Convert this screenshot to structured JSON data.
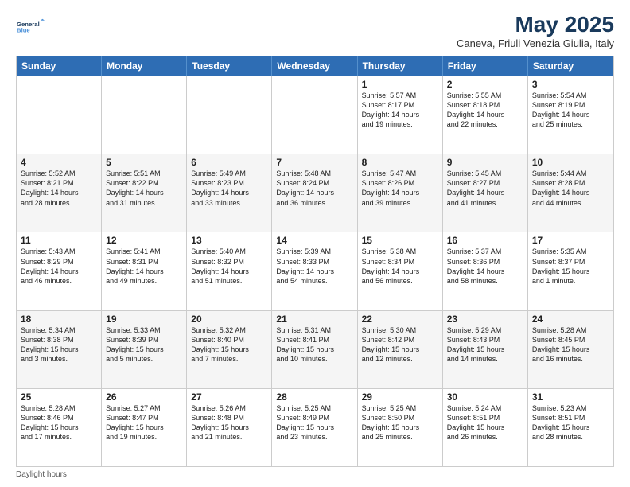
{
  "header": {
    "logo_line1": "General",
    "logo_line2": "Blue",
    "month": "May 2025",
    "location": "Caneva, Friuli Venezia Giulia, Italy"
  },
  "days_of_week": [
    "Sunday",
    "Monday",
    "Tuesday",
    "Wednesday",
    "Thursday",
    "Friday",
    "Saturday"
  ],
  "weeks": [
    [
      {
        "day": "",
        "info": ""
      },
      {
        "day": "",
        "info": ""
      },
      {
        "day": "",
        "info": ""
      },
      {
        "day": "",
        "info": ""
      },
      {
        "day": "1",
        "info": "Sunrise: 5:57 AM\nSunset: 8:17 PM\nDaylight: 14 hours\nand 19 minutes."
      },
      {
        "day": "2",
        "info": "Sunrise: 5:55 AM\nSunset: 8:18 PM\nDaylight: 14 hours\nand 22 minutes."
      },
      {
        "day": "3",
        "info": "Sunrise: 5:54 AM\nSunset: 8:19 PM\nDaylight: 14 hours\nand 25 minutes."
      }
    ],
    [
      {
        "day": "4",
        "info": "Sunrise: 5:52 AM\nSunset: 8:21 PM\nDaylight: 14 hours\nand 28 minutes."
      },
      {
        "day": "5",
        "info": "Sunrise: 5:51 AM\nSunset: 8:22 PM\nDaylight: 14 hours\nand 31 minutes."
      },
      {
        "day": "6",
        "info": "Sunrise: 5:49 AM\nSunset: 8:23 PM\nDaylight: 14 hours\nand 33 minutes."
      },
      {
        "day": "7",
        "info": "Sunrise: 5:48 AM\nSunset: 8:24 PM\nDaylight: 14 hours\nand 36 minutes."
      },
      {
        "day": "8",
        "info": "Sunrise: 5:47 AM\nSunset: 8:26 PM\nDaylight: 14 hours\nand 39 minutes."
      },
      {
        "day": "9",
        "info": "Sunrise: 5:45 AM\nSunset: 8:27 PM\nDaylight: 14 hours\nand 41 minutes."
      },
      {
        "day": "10",
        "info": "Sunrise: 5:44 AM\nSunset: 8:28 PM\nDaylight: 14 hours\nand 44 minutes."
      }
    ],
    [
      {
        "day": "11",
        "info": "Sunrise: 5:43 AM\nSunset: 8:29 PM\nDaylight: 14 hours\nand 46 minutes."
      },
      {
        "day": "12",
        "info": "Sunrise: 5:41 AM\nSunset: 8:31 PM\nDaylight: 14 hours\nand 49 minutes."
      },
      {
        "day": "13",
        "info": "Sunrise: 5:40 AM\nSunset: 8:32 PM\nDaylight: 14 hours\nand 51 minutes."
      },
      {
        "day": "14",
        "info": "Sunrise: 5:39 AM\nSunset: 8:33 PM\nDaylight: 14 hours\nand 54 minutes."
      },
      {
        "day": "15",
        "info": "Sunrise: 5:38 AM\nSunset: 8:34 PM\nDaylight: 14 hours\nand 56 minutes."
      },
      {
        "day": "16",
        "info": "Sunrise: 5:37 AM\nSunset: 8:36 PM\nDaylight: 14 hours\nand 58 minutes."
      },
      {
        "day": "17",
        "info": "Sunrise: 5:35 AM\nSunset: 8:37 PM\nDaylight: 15 hours\nand 1 minute."
      }
    ],
    [
      {
        "day": "18",
        "info": "Sunrise: 5:34 AM\nSunset: 8:38 PM\nDaylight: 15 hours\nand 3 minutes."
      },
      {
        "day": "19",
        "info": "Sunrise: 5:33 AM\nSunset: 8:39 PM\nDaylight: 15 hours\nand 5 minutes."
      },
      {
        "day": "20",
        "info": "Sunrise: 5:32 AM\nSunset: 8:40 PM\nDaylight: 15 hours\nand 7 minutes."
      },
      {
        "day": "21",
        "info": "Sunrise: 5:31 AM\nSunset: 8:41 PM\nDaylight: 15 hours\nand 10 minutes."
      },
      {
        "day": "22",
        "info": "Sunrise: 5:30 AM\nSunset: 8:42 PM\nDaylight: 15 hours\nand 12 minutes."
      },
      {
        "day": "23",
        "info": "Sunrise: 5:29 AM\nSunset: 8:43 PM\nDaylight: 15 hours\nand 14 minutes."
      },
      {
        "day": "24",
        "info": "Sunrise: 5:28 AM\nSunset: 8:45 PM\nDaylight: 15 hours\nand 16 minutes."
      }
    ],
    [
      {
        "day": "25",
        "info": "Sunrise: 5:28 AM\nSunset: 8:46 PM\nDaylight: 15 hours\nand 17 minutes."
      },
      {
        "day": "26",
        "info": "Sunrise: 5:27 AM\nSunset: 8:47 PM\nDaylight: 15 hours\nand 19 minutes."
      },
      {
        "day": "27",
        "info": "Sunrise: 5:26 AM\nSunset: 8:48 PM\nDaylight: 15 hours\nand 21 minutes."
      },
      {
        "day": "28",
        "info": "Sunrise: 5:25 AM\nSunset: 8:49 PM\nDaylight: 15 hours\nand 23 minutes."
      },
      {
        "day": "29",
        "info": "Sunrise: 5:25 AM\nSunset: 8:50 PM\nDaylight: 15 hours\nand 25 minutes."
      },
      {
        "day": "30",
        "info": "Sunrise: 5:24 AM\nSunset: 8:51 PM\nDaylight: 15 hours\nand 26 minutes."
      },
      {
        "day": "31",
        "info": "Sunrise: 5:23 AM\nSunset: 8:51 PM\nDaylight: 15 hours\nand 28 minutes."
      }
    ]
  ],
  "footer": {
    "note": "Daylight hours"
  }
}
